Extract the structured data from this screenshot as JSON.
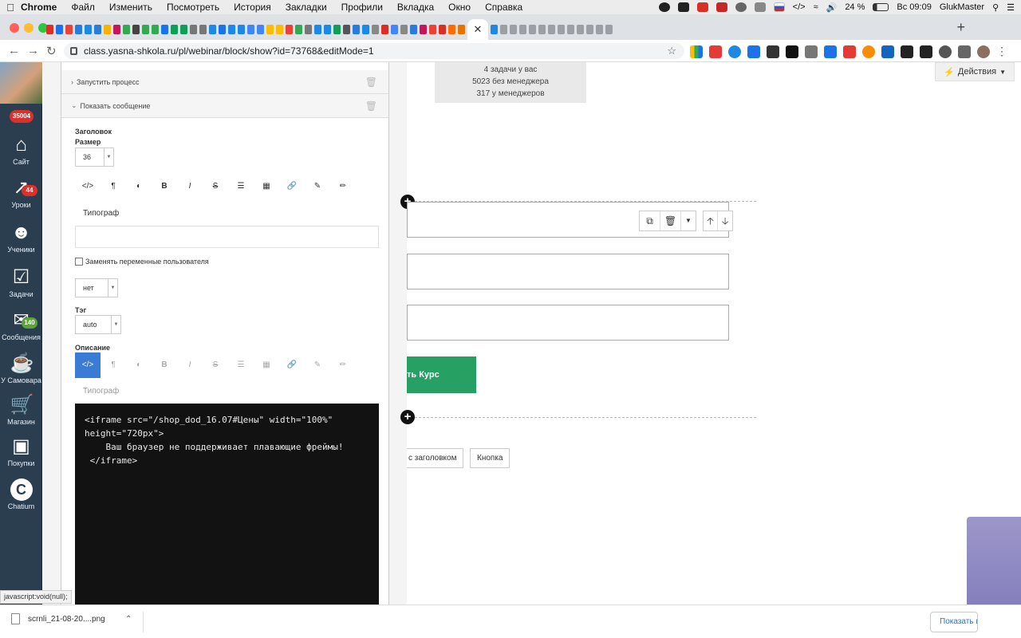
{
  "menubar": {
    "items": [
      "Chrome",
      "Файл",
      "Изменить",
      "Посмотреть",
      "История",
      "Закладки",
      "Профили",
      "Вкладка",
      "Окно",
      "Справка"
    ],
    "battery": "24 %",
    "clock": "Вс 09:09",
    "user": "GlukMaster"
  },
  "browser": {
    "url": "class.yasna-shkola.ru/pl/webinar/block/show?id=73768&editMode=1",
    "new_tab": "+",
    "active_tab_close": "✕",
    "tab_colors": [
      "#d93025",
      "#1a73e8",
      "#ea4335",
      "#2b7bd9",
      "#1e88e5",
      "#2b7bd9",
      "#f4b400",
      "#c2185b",
      "#34a853",
      "#444",
      "#34a853",
      "#34a853",
      "#1a73e8",
      "#0f9d58",
      "#0f9d58",
      "#777",
      "#777",
      "#1e88e5",
      "#1a73e8",
      "#1e88e5",
      "#1e88e5",
      "#4285f4",
      "#4285f4",
      "#fbbc05",
      "#fbbc05",
      "#ea4335",
      "#34a853",
      "#777",
      "#1e88e5",
      "#1e88e5",
      "#0f9d58",
      "#555",
      "#2b7bd9",
      "#1e88e5",
      "#888",
      "#d93025",
      "#4285f4",
      "#888",
      "#2b7bd9",
      "#c2185b",
      "#ea4335",
      "#d93025",
      "#ff6d00",
      "#e37400",
      "#1e88e5",
      "#9aa0a6",
      "#9aa0a6",
      "#9aa0a6",
      "#9aa0a6",
      "#9aa0a6",
      "#9aa0a6",
      "#9aa0a6",
      "#9aa0a6",
      "#9aa0a6",
      "#9aa0a6",
      "#9aa0a6",
      "#9aa0a6"
    ]
  },
  "sidebar": {
    "main_badge": "35004",
    "items": [
      {
        "label": "Сайт",
        "icon": "home-icon",
        "badge": ""
      },
      {
        "label": "Уроки",
        "icon": "chart-icon",
        "badge": "44",
        "badge_color": "#d9312c"
      },
      {
        "label": "Ученики",
        "icon": "users-icon",
        "badge": ""
      },
      {
        "label": "Задачи",
        "icon": "checkbox-icon",
        "badge": ""
      },
      {
        "label": "Сообщения",
        "icon": "envelope-icon",
        "badge": "140",
        "badge_color": "#5aa43a"
      },
      {
        "label": "У Самовара",
        "icon": "samovar-icon",
        "badge": ""
      },
      {
        "label": "Магазин",
        "icon": "cart-icon",
        "badge": ""
      },
      {
        "label": "Покупки",
        "icon": "safe-icon",
        "badge": ""
      },
      {
        "label": "Chatium",
        "icon": "chatium-icon",
        "badge": ""
      }
    ]
  },
  "panel": {
    "run_process": "Запустить процесс",
    "show_message": "Показать сообщение",
    "heading_label": "Заголовок",
    "size_label": "Размер",
    "size_value": "36",
    "typograph_label": "Типограф",
    "replace_vars_label": "Заменять переменные пользователя",
    "no_value": "нет",
    "tag_label": "Тэг",
    "tag_value": "auto",
    "description_label": "Описание",
    "typograph_label_2": "Типограф",
    "code": "<iframe src=\"/shop_dod_16.07#Цены\" width=\"100%\"\nheight=\"720px\">\n    Ваш браузер не поддерживает плавающие фреймы!\n </iframe>"
  },
  "canvas": {
    "stats_line1": "4 задачи у вас",
    "stats_line2": "5023 без менеджера",
    "stats_line3": "317 у менеджеров",
    "actions_button": "Действия",
    "green_button": "ть Курс",
    "button_with_heading": "с заголовком",
    "button_plain": "Кнопка"
  },
  "status_tip": "javascript:void(null);",
  "downloads": {
    "filename": "scrnli_21-08-20....png",
    "show_all": "Показать все"
  }
}
